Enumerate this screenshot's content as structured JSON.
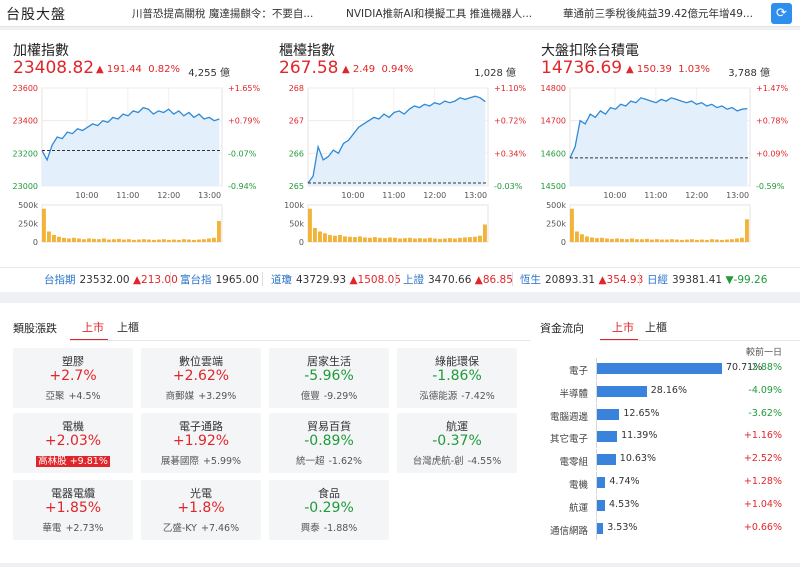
{
  "header": {
    "title": "台股大盤",
    "news": [
      "川普恐提高關稅 魔達揚麒令：不要自...",
      "NVIDIA推新AI和模擬工具 推進機器人...",
      "華通前三季稅後純益39.42億元年增49..."
    ],
    "refresh_icon": "refresh-icon"
  },
  "indices": [
    {
      "name": "加權指數",
      "value": "23408.82",
      "change": "▲ 191.44",
      "pct": "0.82%",
      "volume": "4,255 億",
      "y_ticks": [
        "23600",
        "23400",
        "23200",
        "23000"
      ],
      "pct_ticks": [
        "+1.65%",
        "+0.79%",
        "-0.07%",
        "-0.94%"
      ],
      "x_ticks": [
        "10:00",
        "11:00",
        "12:00",
        "13:00"
      ],
      "vol_ticks": [
        "500k",
        "250k",
        "0"
      ],
      "ylim": [
        23000,
        23600
      ],
      "ref": 23217,
      "series": [
        23217,
        23160,
        23250,
        23300,
        23290,
        23330,
        23320,
        23350,
        23340,
        23360,
        23380,
        23370,
        23400,
        23390,
        23420,
        23410,
        23440,
        23430,
        23460,
        23450,
        23480,
        23470,
        23440,
        23460,
        23450,
        23470,
        23440,
        23460,
        23430,
        23450,
        23420,
        23440,
        23410,
        23420,
        23400,
        23410
      ],
      "vol_series": [
        0.95,
        0.3,
        0.2,
        0.15,
        0.12,
        0.1,
        0.12,
        0.1,
        0.08,
        0.1,
        0.09,
        0.08,
        0.1,
        0.07,
        0.08,
        0.09,
        0.07,
        0.08,
        0.06,
        0.07,
        0.08,
        0.07,
        0.06,
        0.07,
        0.08,
        0.06,
        0.07,
        0.06,
        0.08,
        0.07,
        0.06,
        0.07,
        0.08,
        0.1,
        0.12,
        0.6
      ]
    },
    {
      "name": "櫃檯指數",
      "value": "267.58",
      "change": "▲ 2.49",
      "pct": "0.94%",
      "volume": "1,028 億",
      "y_ticks": [
        "268",
        "267",
        "266",
        "265"
      ],
      "pct_ticks": [
        "+1.10%",
        "+0.72%",
        "+0.34%",
        "-0.03%"
      ],
      "x_ticks": [
        "10:00",
        "11:00",
        "12:00",
        "13:00"
      ],
      "vol_ticks": [
        "100k",
        "50k",
        "0"
      ],
      "ylim": [
        265,
        268
      ],
      "ref": 265.09,
      "series": [
        265.09,
        265.3,
        266.2,
        265.8,
        265.9,
        266.1,
        266.0,
        266.3,
        266.4,
        266.6,
        266.8,
        266.9,
        267.0,
        267.1,
        267.05,
        267.2,
        267.1,
        267.25,
        267.3,
        267.2,
        267.35,
        267.45,
        267.4,
        267.5,
        267.45,
        267.55,
        267.5,
        267.6,
        267.55,
        267.6,
        267.7,
        267.65,
        267.7,
        267.75,
        267.7,
        267.58
      ],
      "vol_series": [
        0.95,
        0.4,
        0.3,
        0.25,
        0.2,
        0.18,
        0.2,
        0.16,
        0.15,
        0.14,
        0.16,
        0.13,
        0.12,
        0.14,
        0.12,
        0.11,
        0.13,
        0.12,
        0.1,
        0.11,
        0.12,
        0.1,
        0.11,
        0.1,
        0.12,
        0.1,
        0.09,
        0.1,
        0.11,
        0.1,
        0.12,
        0.13,
        0.14,
        0.15,
        0.18,
        0.5
      ]
    },
    {
      "name": "大盤扣除台積電",
      "value": "14736.69",
      "change": "▲ 150.39",
      "pct": "1.03%",
      "volume": "3,788 億",
      "y_ticks": [
        "14800",
        "14700",
        "14600",
        "14500"
      ],
      "pct_ticks": [
        "+1.47%",
        "+0.78%",
        "+0.09%",
        "-0.59%"
      ],
      "x_ticks": [
        "10:00",
        "11:00",
        "12:00",
        "13:00"
      ],
      "vol_ticks": [
        "500k",
        "250k",
        "0"
      ],
      "ylim": [
        14500,
        14800
      ],
      "ref": 14586,
      "series": [
        14586,
        14620,
        14700,
        14690,
        14720,
        14710,
        14730,
        14720,
        14740,
        14735,
        14750,
        14745,
        14760,
        14755,
        14770,
        14765,
        14760,
        14755,
        14765,
        14760,
        14770,
        14765,
        14760,
        14755,
        14760,
        14750,
        14755,
        14745,
        14750,
        14740,
        14745,
        14735,
        14740,
        14730,
        14735,
        14737
      ],
      "vol_series": [
        0.95,
        0.3,
        0.22,
        0.16,
        0.13,
        0.11,
        0.12,
        0.1,
        0.09,
        0.1,
        0.09,
        0.08,
        0.1,
        0.08,
        0.08,
        0.09,
        0.07,
        0.08,
        0.07,
        0.07,
        0.08,
        0.07,
        0.06,
        0.07,
        0.08,
        0.06,
        0.07,
        0.06,
        0.08,
        0.07,
        0.06,
        0.07,
        0.08,
        0.1,
        0.12,
        0.65
      ]
    }
  ],
  "futures": [
    {
      "label": "台指期",
      "value": "23532.00",
      "change": "▲213.00",
      "dir": "up"
    },
    {
      "label": "富台指",
      "value": "1965.00",
      "change": "",
      "dir": "flat"
    },
    {
      "label": "道瓊",
      "value": "43729.93",
      "change": "▲1508.05",
      "dir": "up"
    },
    {
      "label": "上證",
      "value": "3470.66",
      "change": "▲86.85",
      "dir": "up"
    },
    {
      "label": "恆生",
      "value": "20893.31",
      "change": "▲354.93",
      "dir": "up"
    },
    {
      "label": "日經",
      "value": "39381.41",
      "change": "▼-99.26",
      "dir": "down"
    }
  ],
  "sectors": {
    "title": "類股漲跌",
    "tabs": [
      "上市",
      "上櫃"
    ],
    "items": [
      {
        "name": "塑膠",
        "pct": "+2.7%",
        "dir": "up",
        "leader": "亞聚",
        "leader_pct": "+4.5%",
        "highlight": false
      },
      {
        "name": "數位雲端",
        "pct": "+2.62%",
        "dir": "up",
        "leader": "商郵媒",
        "leader_pct": "+3.29%",
        "highlight": false
      },
      {
        "name": "居家生活",
        "pct": "-5.96%",
        "dir": "down",
        "leader": "億豐",
        "leader_pct": "-9.29%",
        "highlight": false
      },
      {
        "name": "綠能環保",
        "pct": "-1.86%",
        "dir": "down",
        "leader": "泓德能源",
        "leader_pct": "-7.42%",
        "highlight": false
      },
      {
        "name": "電機",
        "pct": "+2.03%",
        "dir": "up",
        "leader": "高林股",
        "leader_pct": "+9.81%",
        "highlight": true
      },
      {
        "name": "電子通路",
        "pct": "+1.92%",
        "dir": "up",
        "leader": "展碁國際",
        "leader_pct": "+5.99%",
        "highlight": false
      },
      {
        "name": "貿易百貨",
        "pct": "-0.89%",
        "dir": "down",
        "leader": "統一超",
        "leader_pct": "-1.62%",
        "highlight": false
      },
      {
        "name": "航運",
        "pct": "-0.37%",
        "dir": "down",
        "leader": "台灣虎航-創",
        "leader_pct": "-4.55%",
        "highlight": false
      },
      {
        "name": "電器電纜",
        "pct": "+1.85%",
        "dir": "up",
        "leader": "華電",
        "leader_pct": "+2.73%",
        "highlight": false
      },
      {
        "name": "光電",
        "pct": "+1.8%",
        "dir": "up",
        "leader": "乙盛-KY",
        "leader_pct": "+7.46%",
        "highlight": false
      },
      {
        "name": "食品",
        "pct": "-0.29%",
        "dir": "down",
        "leader": "興泰",
        "leader_pct": "-1.88%",
        "highlight": false
      }
    ]
  },
  "flow": {
    "title": "資金流向",
    "tabs": [
      "上市",
      "上櫃"
    ],
    "prev_label": "較前一日",
    "items": [
      {
        "name": "電子",
        "share": 70.71,
        "pct": "70.71%",
        "chg": "-2.88%",
        "dir": "down"
      },
      {
        "name": "半導體",
        "share": 28.16,
        "pct": "28.16%",
        "chg": "-4.09%",
        "dir": "down"
      },
      {
        "name": "電腦週邊",
        "share": 12.65,
        "pct": "12.65%",
        "chg": "-3.62%",
        "dir": "down"
      },
      {
        "name": "其它電子",
        "share": 11.39,
        "pct": "11.39%",
        "chg": "+1.16%",
        "dir": "up"
      },
      {
        "name": "電零組",
        "share": 10.63,
        "pct": "10.63%",
        "chg": "+2.52%",
        "dir": "up"
      },
      {
        "name": "電機",
        "share": 4.74,
        "pct": "4.74%",
        "chg": "+1.28%",
        "dir": "up"
      },
      {
        "name": "航運",
        "share": 4.53,
        "pct": "4.53%",
        "chg": "+1.04%",
        "dir": "up"
      },
      {
        "name": "通信網路",
        "share": 3.53,
        "pct": "3.53%",
        "chg": "+0.66%",
        "dir": "up"
      }
    ]
  }
}
